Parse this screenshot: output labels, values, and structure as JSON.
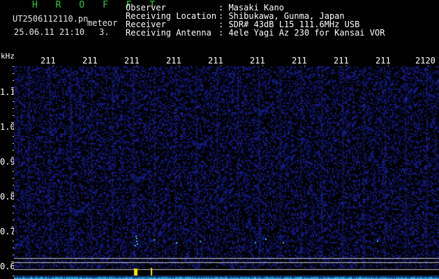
{
  "header": {
    "app_title": "H R O F F T",
    "file_name": "UT2506112110.pn",
    "tag": "meteor",
    "datetime": "25.06.11 21:10",
    "counter": "3.",
    "fields": [
      {
        "label": "Observer",
        "value": ": Masaki Kano"
      },
      {
        "label": "Receiving Location",
        "value": ": Shibukawa, Gunma, Japan"
      },
      {
        "label": "Receiver",
        "value": ": SDR# 43dB L15 111.6MHz USB"
      },
      {
        "label": "Receiving Antenna",
        "value": ": 4ele Yagi Az 230 for Kansai VOR"
      }
    ]
  },
  "axes": {
    "x_unit": "kHz",
    "x_ticks": [
      "211",
      "211",
      "211",
      "211",
      "211",
      "211",
      "211",
      "211",
      "211",
      "2120"
    ],
    "y_ticks": [
      "1.1",
      "1.0",
      "0.9",
      "0.8",
      "0.7",
      "0.6"
    ]
  },
  "colors": {
    "title": "#2ecc40",
    "noise_blue": "#1a2a9a",
    "signal_cyan": "#38c8f0",
    "marker_yellow": "#f5e600",
    "guide_line": "#c8c8c8"
  }
}
